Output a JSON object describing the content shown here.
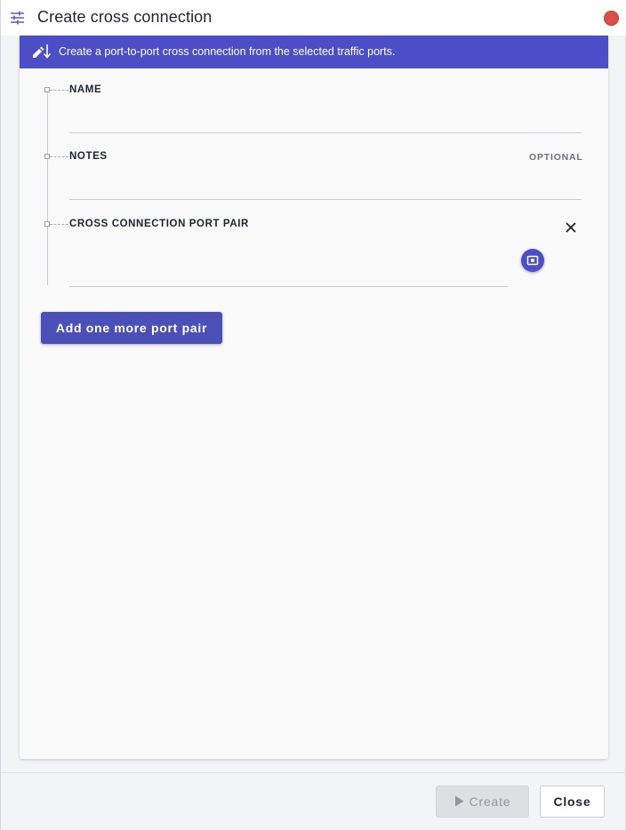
{
  "window": {
    "title": "Create cross connection",
    "title_icon": "sliders-icon",
    "close_color": "#dc4f47"
  },
  "banner": {
    "icon": "edit-sort-icon",
    "text": "Create a port-to-port cross connection from the selected traffic ports.",
    "background": "#4b4ec7"
  },
  "form": {
    "name": {
      "label": "NAME",
      "value": "",
      "placeholder": ""
    },
    "notes": {
      "label": "NOTES",
      "optional_label": "OPTIONAL",
      "value": "",
      "placeholder": ""
    },
    "port_pair": {
      "label": "CROSS CONNECTION PORT PAIR",
      "value": "",
      "remove_icon": "close-icon",
      "picker_icon": "port-picker-icon"
    }
  },
  "actions": {
    "add_pair_label": "Add one more port pair",
    "create_label": "Create",
    "create_icon": "play-icon",
    "create_disabled": true,
    "close_label": "Close"
  }
}
